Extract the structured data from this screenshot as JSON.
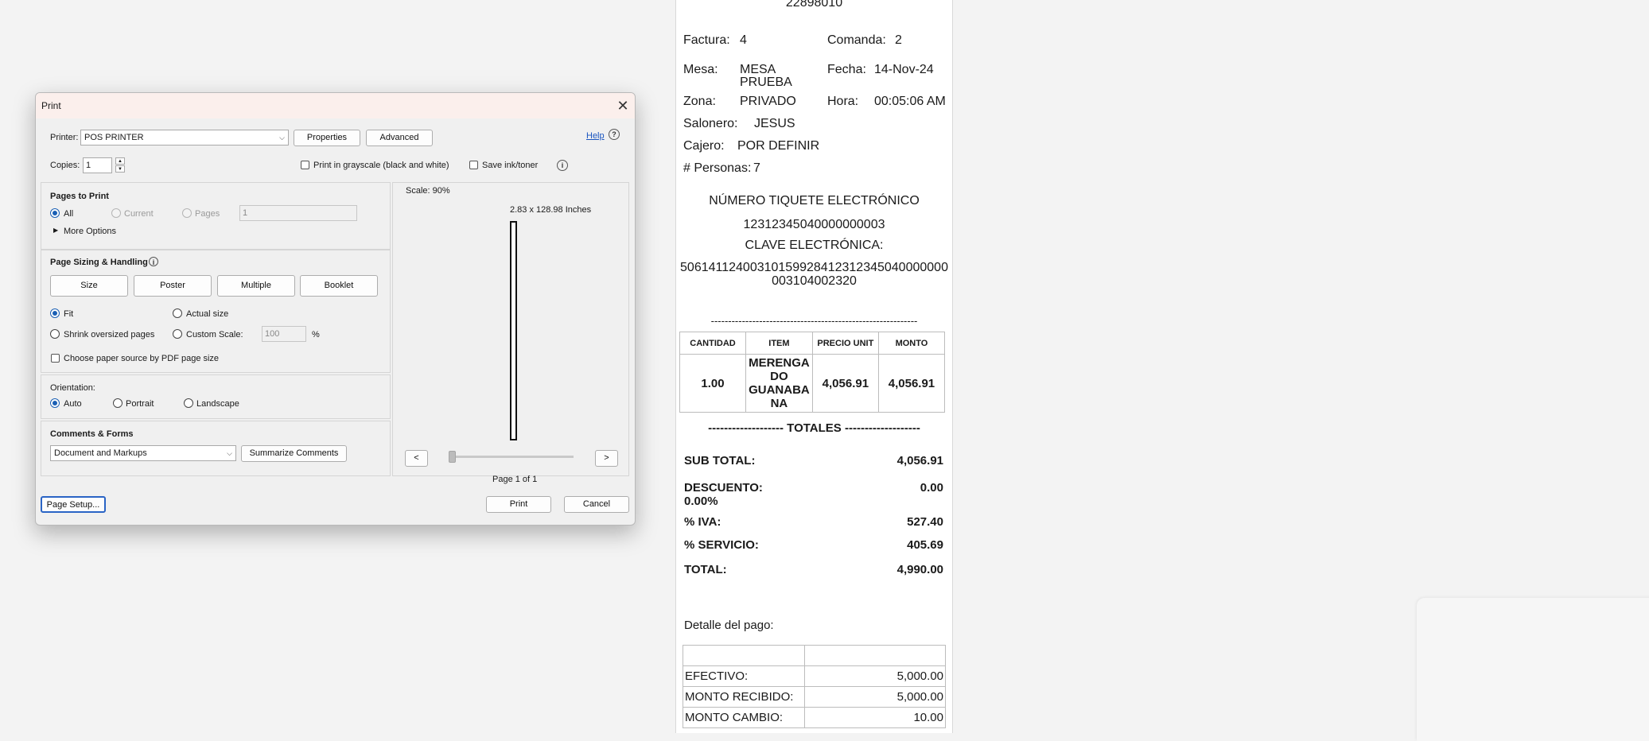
{
  "receipt": {
    "cedula": "22898010",
    "factura_label": "Factura:",
    "factura_value": "4",
    "comanda_label": "Comanda:",
    "comanda_value": "2",
    "mesa_label": "Mesa:",
    "mesa_value_line1": "MESA",
    "mesa_value_line2": "PRUEBA",
    "fecha_label": "Fecha:",
    "fecha_value": "14-Nov-24",
    "zona_label": "Zona:",
    "zona_value": "PRIVADO",
    "hora_label": "Hora:",
    "hora_value": "00:05:06 AM",
    "salonero_label": "Salonero:",
    "salonero_value": "JESUS",
    "cajero_label": "Cajero:",
    "cajero_value": "POR DEFINIR",
    "personas_label": "# Personas:",
    "personas_value": "7",
    "tiquete_title": "NÚMERO TIQUETE ELECTRÓNICO",
    "tiquete_number": "12312345040000000003",
    "clave_title": "CLAVE ELECTRÓNICA:",
    "clave_line1": "50614112400310159928412312345040000000",
    "clave_line2": "003104002320",
    "separator": "------------------------------------------------------------",
    "items_headers": [
      "CANTIDAD",
      "ITEM",
      "PRECIO UNIT",
      "MONTO"
    ],
    "items": [
      {
        "cantidad": "1.00",
        "item_lines": [
          "MERENGA",
          "DO",
          "GUANABA",
          "NA"
        ],
        "precio": "4,056.91",
        "monto": "4,056.91"
      }
    ],
    "totales_line": "------------------- TOTALES -------------------",
    "totals": {
      "subtotal_label": "SUB TOTAL:",
      "subtotal_value": "4,056.91",
      "descuento_label_line1": "DESCUENTO:",
      "descuento_label_line2": "0.00%",
      "descuento_value": "0.00",
      "iva_label": "% IVA:",
      "iva_value": "527.40",
      "servicio_label": "% SERVICIO:",
      "servicio_value": "405.69",
      "total_label": "TOTAL:",
      "total_value": "4,990.00"
    },
    "pago_title": "Detalle del pago:",
    "payments": [
      {
        "label": "",
        "value": ""
      },
      {
        "label": "EFECTIVO:",
        "value": "5,000.00"
      },
      {
        "label": "MONTO RECIBIDO:",
        "value": "5,000.00"
      },
      {
        "label": "MONTO CAMBIO:",
        "value": "10.00"
      }
    ]
  },
  "dialog": {
    "title": "Print",
    "close_glyph": "✕",
    "printer_label": "Printer:",
    "printer_value": "POS PRINTER",
    "properties_label": "Properties",
    "advanced_label": "Advanced",
    "help_label": "Help",
    "copies_label": "Copies:",
    "copies_value": "1",
    "grayscale_label": "Print in grayscale (black and white)",
    "save_ink_label": "Save ink/toner",
    "pages_to_print_title": "Pages to Print",
    "all_label": "All",
    "current_label": "Current",
    "pages_label": "Pages",
    "pages_value": "1",
    "more_options_label": "More Options",
    "sizing_title": "Page Sizing & Handling",
    "size_label": "Size",
    "poster_label": "Poster",
    "multiple_label": "Multiple",
    "booklet_label": "Booklet",
    "fit_label": "Fit",
    "actual_size_label": "Actual size",
    "shrink_label": "Shrink oversized pages",
    "custom_scale_label": "Custom Scale:",
    "custom_scale_value": "100",
    "percent_label": "%",
    "paper_source_label": "Choose paper source by PDF page size",
    "orientation_title": "Orientation:",
    "auto_label": "Auto",
    "portrait_label": "Portrait",
    "landscape_label": "Landscape",
    "comments_title": "Comments & Forms",
    "comments_value": "Document and Markups",
    "summarize_label": "Summarize Comments",
    "scale_text": "Scale:  90%",
    "dimensions_text": "2.83 x 128.98 Inches",
    "prev_label": "<",
    "next_label": ">",
    "page_of_text": "Page 1 of 1",
    "page_setup_label": "Page Setup...",
    "print_label": "Print",
    "cancel_label": "Cancel"
  }
}
